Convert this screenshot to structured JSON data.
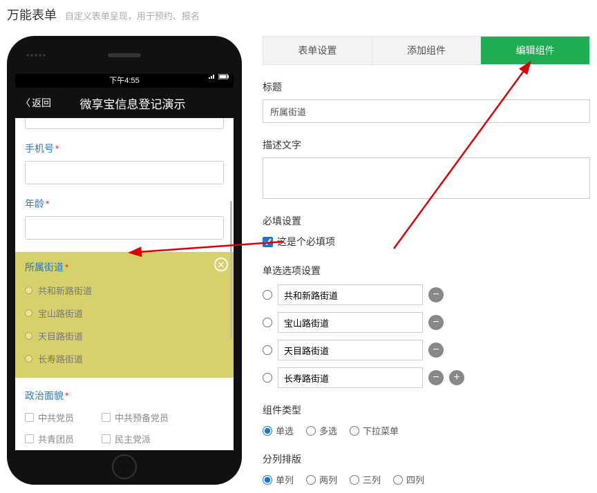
{
  "page": {
    "title": "万能表单",
    "subtitle": "自定义表单呈现，用于预约、报名"
  },
  "status_time": "下午4:55",
  "nav": {
    "back": "返回",
    "title": "微享宝信息登记演示"
  },
  "form": {
    "phone_label": "手机号",
    "age_label": "年龄",
    "street_label": "所属街道",
    "street_options": [
      "共和新路街道",
      "宝山路街道",
      "天目路街道",
      "长寿路街道"
    ],
    "political_label": "政治面貌",
    "political_options": [
      [
        "中共党员",
        "中共预备党员"
      ],
      [
        "共青团员",
        "民主党派"
      ]
    ]
  },
  "tabs": {
    "t1": "表单设置",
    "t2": "添加组件",
    "t3": "编辑组件"
  },
  "editor": {
    "title_label": "标题",
    "title_value": "所属街道",
    "desc_label": "描述文字",
    "required_label": "必填设置",
    "required_checkbox": "这是个必填项",
    "radio_options_label": "单选选项设置",
    "options": [
      "共和新路街道",
      "宝山路街道",
      "天目路街道",
      "长寿路街道"
    ],
    "comp_type_label": "组件类型",
    "comp_types": [
      "单选",
      "多选",
      "下拉菜单"
    ],
    "column_label": "分列排版",
    "columns": [
      "单列",
      "两列",
      "三列",
      "四列"
    ]
  }
}
